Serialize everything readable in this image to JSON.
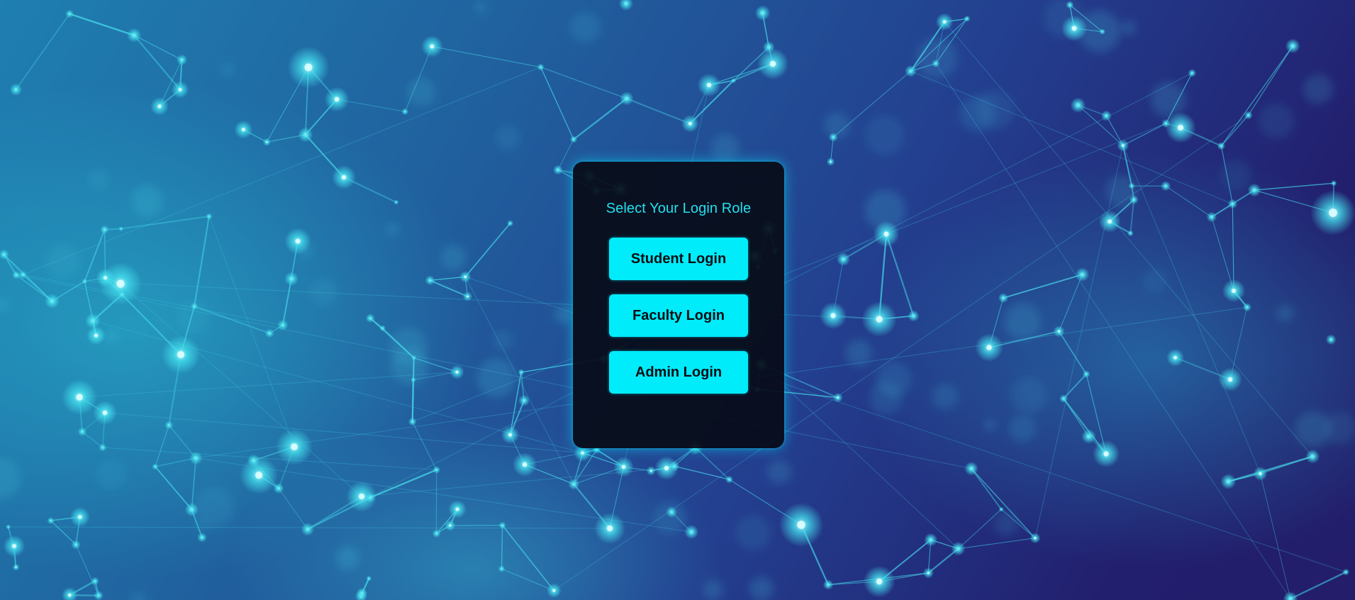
{
  "background": {
    "description_icon": "network-mesh-background",
    "colors": {
      "deep": "#221f6e",
      "mid": "#20629f",
      "glow": "#2fe0ee"
    }
  },
  "card": {
    "title": "Select Your Login Role",
    "buttons": [
      {
        "label": "Student Login"
      },
      {
        "label": "Faculty Login"
      },
      {
        "label": "Admin Login"
      }
    ]
  },
  "theme": {
    "accent": "#00ecfb",
    "card_background": "#080c18",
    "title_color": "#22e0ee"
  }
}
